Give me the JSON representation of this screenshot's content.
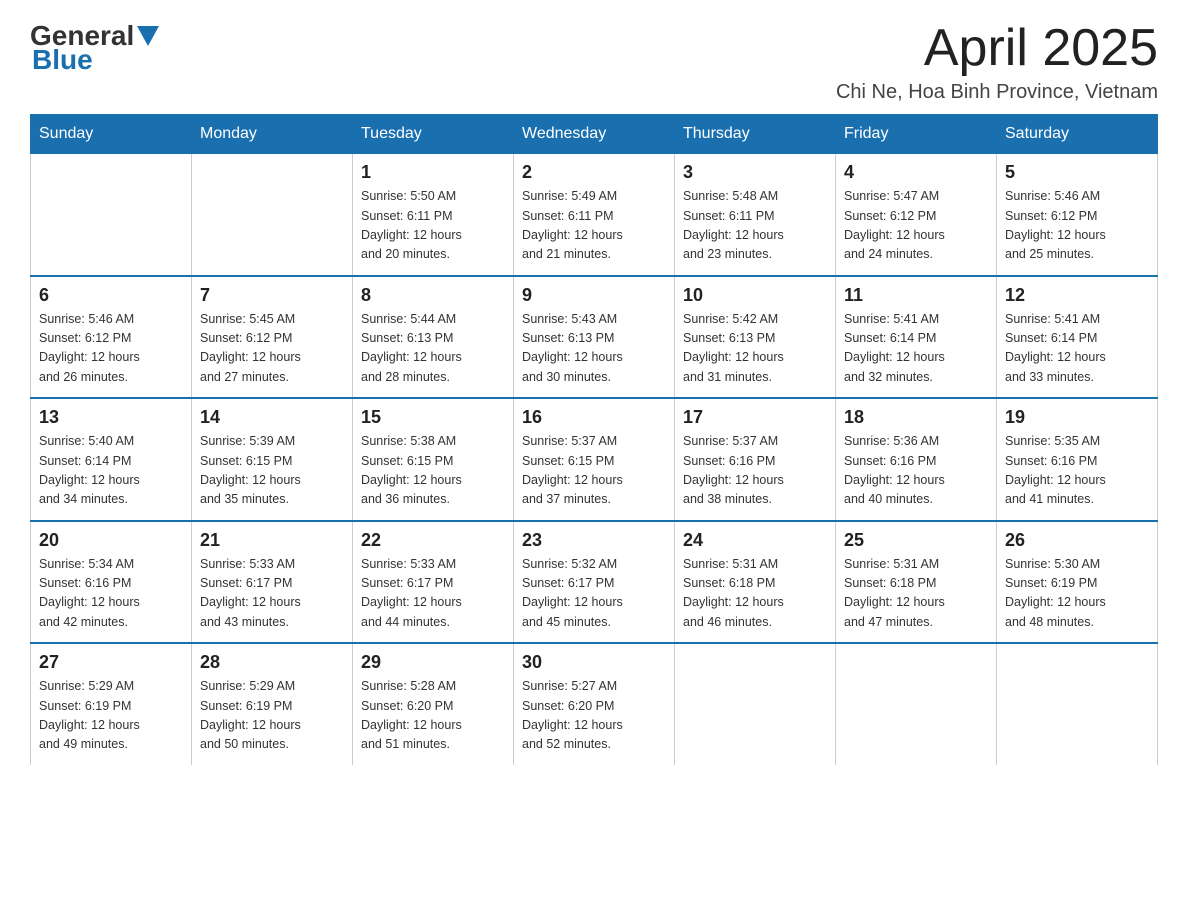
{
  "logo": {
    "text_general": "General",
    "text_blue": "Blue"
  },
  "header": {
    "month_title": "April 2025",
    "location": "Chi Ne, Hoa Binh Province, Vietnam"
  },
  "weekdays": [
    "Sunday",
    "Monday",
    "Tuesday",
    "Wednesday",
    "Thursday",
    "Friday",
    "Saturday"
  ],
  "weeks": [
    [
      {
        "day": "",
        "info": ""
      },
      {
        "day": "",
        "info": ""
      },
      {
        "day": "1",
        "info": "Sunrise: 5:50 AM\nSunset: 6:11 PM\nDaylight: 12 hours\nand 20 minutes."
      },
      {
        "day": "2",
        "info": "Sunrise: 5:49 AM\nSunset: 6:11 PM\nDaylight: 12 hours\nand 21 minutes."
      },
      {
        "day": "3",
        "info": "Sunrise: 5:48 AM\nSunset: 6:11 PM\nDaylight: 12 hours\nand 23 minutes."
      },
      {
        "day": "4",
        "info": "Sunrise: 5:47 AM\nSunset: 6:12 PM\nDaylight: 12 hours\nand 24 minutes."
      },
      {
        "day": "5",
        "info": "Sunrise: 5:46 AM\nSunset: 6:12 PM\nDaylight: 12 hours\nand 25 minutes."
      }
    ],
    [
      {
        "day": "6",
        "info": "Sunrise: 5:46 AM\nSunset: 6:12 PM\nDaylight: 12 hours\nand 26 minutes."
      },
      {
        "day": "7",
        "info": "Sunrise: 5:45 AM\nSunset: 6:12 PM\nDaylight: 12 hours\nand 27 minutes."
      },
      {
        "day": "8",
        "info": "Sunrise: 5:44 AM\nSunset: 6:13 PM\nDaylight: 12 hours\nand 28 minutes."
      },
      {
        "day": "9",
        "info": "Sunrise: 5:43 AM\nSunset: 6:13 PM\nDaylight: 12 hours\nand 30 minutes."
      },
      {
        "day": "10",
        "info": "Sunrise: 5:42 AM\nSunset: 6:13 PM\nDaylight: 12 hours\nand 31 minutes."
      },
      {
        "day": "11",
        "info": "Sunrise: 5:41 AM\nSunset: 6:14 PM\nDaylight: 12 hours\nand 32 minutes."
      },
      {
        "day": "12",
        "info": "Sunrise: 5:41 AM\nSunset: 6:14 PM\nDaylight: 12 hours\nand 33 minutes."
      }
    ],
    [
      {
        "day": "13",
        "info": "Sunrise: 5:40 AM\nSunset: 6:14 PM\nDaylight: 12 hours\nand 34 minutes."
      },
      {
        "day": "14",
        "info": "Sunrise: 5:39 AM\nSunset: 6:15 PM\nDaylight: 12 hours\nand 35 minutes."
      },
      {
        "day": "15",
        "info": "Sunrise: 5:38 AM\nSunset: 6:15 PM\nDaylight: 12 hours\nand 36 minutes."
      },
      {
        "day": "16",
        "info": "Sunrise: 5:37 AM\nSunset: 6:15 PM\nDaylight: 12 hours\nand 37 minutes."
      },
      {
        "day": "17",
        "info": "Sunrise: 5:37 AM\nSunset: 6:16 PM\nDaylight: 12 hours\nand 38 minutes."
      },
      {
        "day": "18",
        "info": "Sunrise: 5:36 AM\nSunset: 6:16 PM\nDaylight: 12 hours\nand 40 minutes."
      },
      {
        "day": "19",
        "info": "Sunrise: 5:35 AM\nSunset: 6:16 PM\nDaylight: 12 hours\nand 41 minutes."
      }
    ],
    [
      {
        "day": "20",
        "info": "Sunrise: 5:34 AM\nSunset: 6:16 PM\nDaylight: 12 hours\nand 42 minutes."
      },
      {
        "day": "21",
        "info": "Sunrise: 5:33 AM\nSunset: 6:17 PM\nDaylight: 12 hours\nand 43 minutes."
      },
      {
        "day": "22",
        "info": "Sunrise: 5:33 AM\nSunset: 6:17 PM\nDaylight: 12 hours\nand 44 minutes."
      },
      {
        "day": "23",
        "info": "Sunrise: 5:32 AM\nSunset: 6:17 PM\nDaylight: 12 hours\nand 45 minutes."
      },
      {
        "day": "24",
        "info": "Sunrise: 5:31 AM\nSunset: 6:18 PM\nDaylight: 12 hours\nand 46 minutes."
      },
      {
        "day": "25",
        "info": "Sunrise: 5:31 AM\nSunset: 6:18 PM\nDaylight: 12 hours\nand 47 minutes."
      },
      {
        "day": "26",
        "info": "Sunrise: 5:30 AM\nSunset: 6:19 PM\nDaylight: 12 hours\nand 48 minutes."
      }
    ],
    [
      {
        "day": "27",
        "info": "Sunrise: 5:29 AM\nSunset: 6:19 PM\nDaylight: 12 hours\nand 49 minutes."
      },
      {
        "day": "28",
        "info": "Sunrise: 5:29 AM\nSunset: 6:19 PM\nDaylight: 12 hours\nand 50 minutes."
      },
      {
        "day": "29",
        "info": "Sunrise: 5:28 AM\nSunset: 6:20 PM\nDaylight: 12 hours\nand 51 minutes."
      },
      {
        "day": "30",
        "info": "Sunrise: 5:27 AM\nSunset: 6:20 PM\nDaylight: 12 hours\nand 52 minutes."
      },
      {
        "day": "",
        "info": ""
      },
      {
        "day": "",
        "info": ""
      },
      {
        "day": "",
        "info": ""
      }
    ]
  ]
}
